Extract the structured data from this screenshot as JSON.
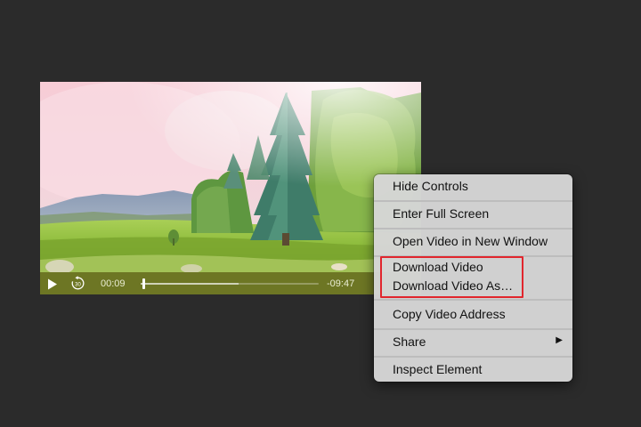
{
  "player": {
    "elapsed": "00:09",
    "remaining": "-09:47",
    "progress": 0.015,
    "buffered": 0.55,
    "play_icon": "play-icon",
    "skip_icon": "skip-back-30-icon",
    "skip_label": "30"
  },
  "context_menu": {
    "items": [
      {
        "label": "Hide Controls"
      },
      {
        "label": "Enter Full Screen"
      },
      {
        "label": "Open Video in New Window"
      },
      {
        "label": "Download Video"
      },
      {
        "label": "Download Video As…"
      },
      {
        "label": "Copy Video Address"
      },
      {
        "label": "Share",
        "submenu_icon": "▶"
      },
      {
        "label": "Inspect Element"
      }
    ]
  },
  "colors": {
    "page_background": "#2b2b2b",
    "controls_bar": "#707a24",
    "menu_background": "#d6d6d6",
    "highlight": "#e1262d"
  }
}
